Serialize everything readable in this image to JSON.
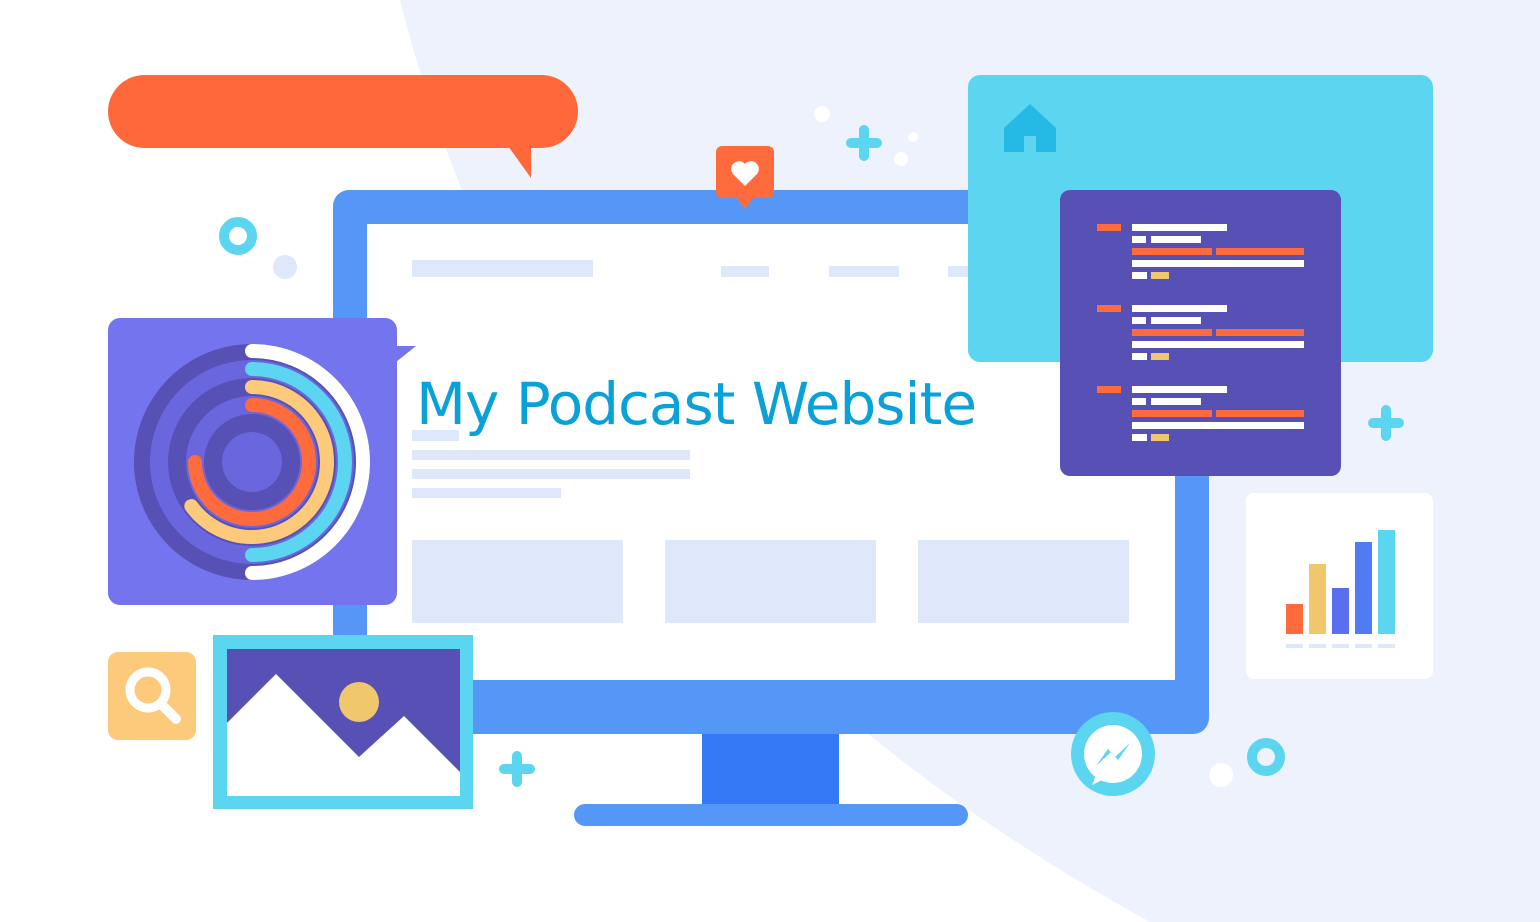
{
  "page": {
    "title": "My Podcast Website"
  },
  "colors": {
    "title_text": "#0aa1d8",
    "background_shape": "#eef2fd",
    "monitor_frame": "#5597f7",
    "monitor_stand": "#3578f5",
    "screen_bg": "#ffffff",
    "placeholder": "#dfe8fa",
    "speech_bubble": "#ff683a",
    "cyan_panel": "#5bd5f0",
    "code_panel": "#5750b5",
    "purple_panel": "#7474ef",
    "accent_orange": "#ff6b3d",
    "accent_yellow": "#fdc97a",
    "accent_cyan": "#5bd5f0",
    "accent_blue": "#4f7cf4"
  },
  "icons": {
    "heart": "heart-icon",
    "home": "home-icon",
    "search": "search-icon",
    "messenger": "messenger-icon",
    "image": "image-icon",
    "radial_chart": "radial-chart-icon",
    "bar_chart": "bar-chart-icon",
    "code": "code-icon",
    "plus": "plus-icon"
  },
  "bar_chart": {
    "values": [
      30,
      70,
      46,
      92,
      104
    ],
    "colors": [
      "#ff6b3d",
      "#f1c76e",
      "#5a6ff0",
      "#4f7cf4",
      "#5bd5f0"
    ]
  },
  "radial_chart": {
    "rings": [
      {
        "fraction": 0.5,
        "color": "#ffffff"
      },
      {
        "fraction": 0.5,
        "color": "#5bd5f0"
      },
      {
        "fraction": 0.65,
        "color": "#fdc97a"
      },
      {
        "fraction": 0.75,
        "color": "#ff6b3d"
      }
    ]
  }
}
